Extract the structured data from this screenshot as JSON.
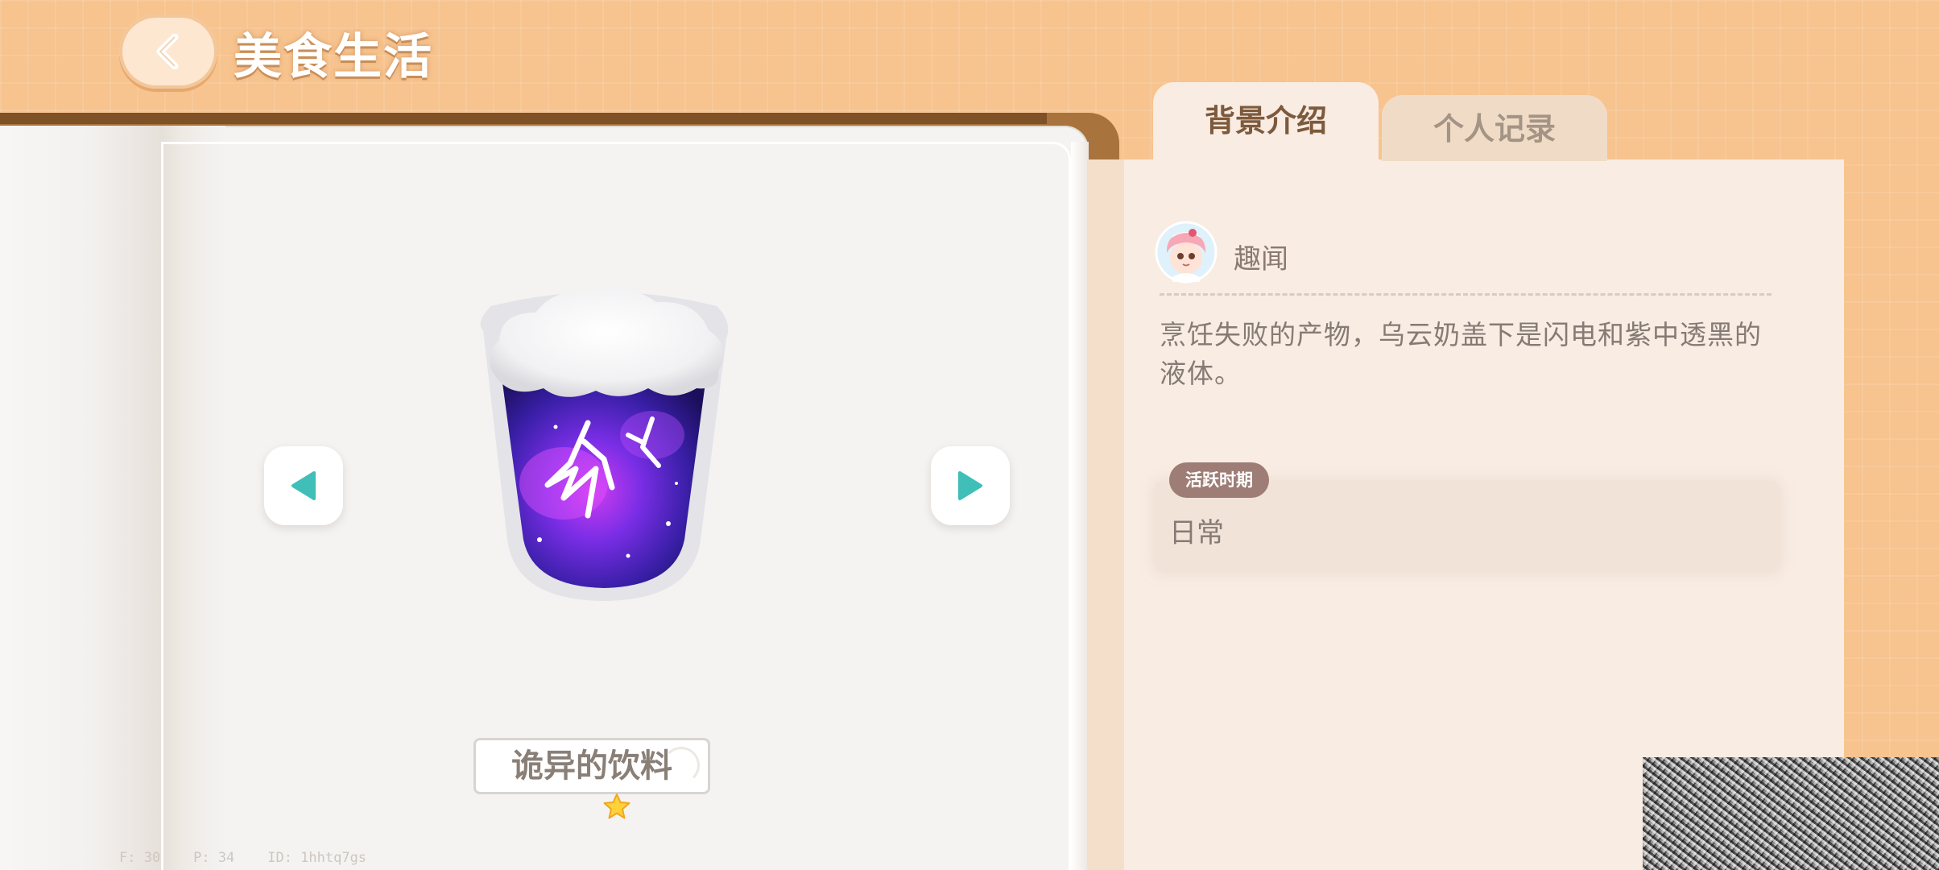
{
  "header": {
    "title": "美食生活",
    "back_icon": "chevron-left-icon"
  },
  "tabs": [
    {
      "label": "背景介绍",
      "active": true
    },
    {
      "label": "个人记录",
      "active": false
    }
  ],
  "item": {
    "name": "诡异的饮料",
    "stars": 1,
    "image": "cloud-topped purple lightning drink"
  },
  "info": {
    "author": "趣闻",
    "description": "烹饪失败的产物，乌云奶盖下是闪电和紫中透黑的液体。",
    "period_label": "活跃时期",
    "period_value": "日常"
  },
  "debug": {
    "text": "F: 30    P: 34    ID: 1hhtq7gs"
  },
  "colors": {
    "background": "#f7c38e",
    "arrow_accent": "#3fbfb7",
    "tab_active_text": "#7d5a3c",
    "tab_inactive_text": "#a49485",
    "period_tag": "#9d7d75"
  }
}
